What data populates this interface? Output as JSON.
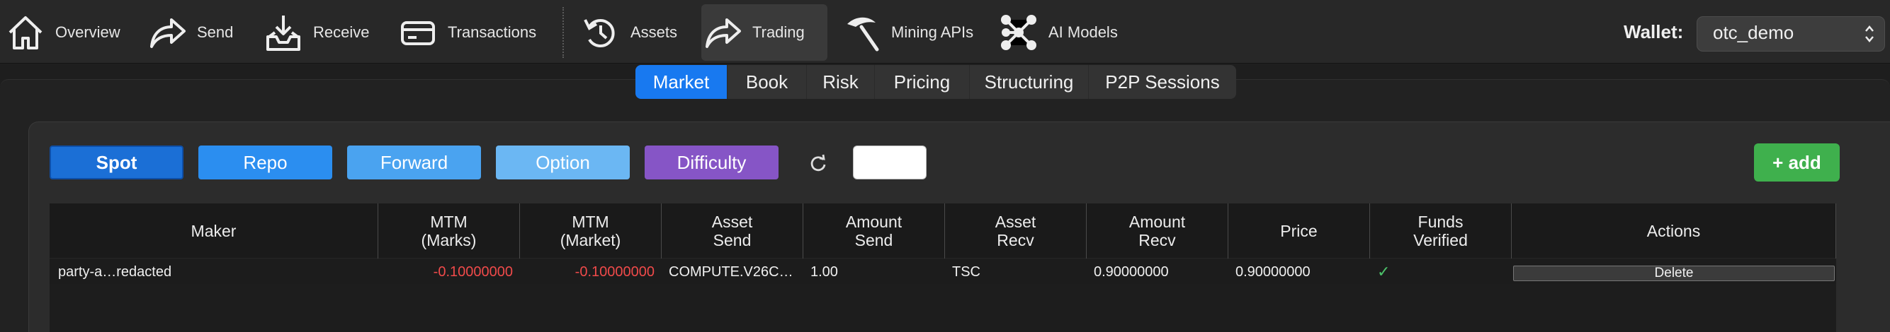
{
  "toolbar": {
    "items": [
      {
        "label": "Overview",
        "icon": "home-icon"
      },
      {
        "label": "Send",
        "icon": "send-arrow-icon"
      },
      {
        "label": "Receive",
        "icon": "receive-tray-icon"
      },
      {
        "label": "Transactions",
        "icon": "card-icon"
      },
      {
        "label": "Assets",
        "icon": "history-icon"
      },
      {
        "label": "Trading",
        "icon": "share-arrow-icon",
        "active": true
      },
      {
        "label": "Mining APIs",
        "icon": "pickaxe-icon"
      },
      {
        "label": "AI Models",
        "icon": "network-nodes-icon"
      }
    ],
    "wallet_label": "Wallet:",
    "wallet_value": "otc_demo"
  },
  "subtabs": [
    "Market",
    "Book",
    "Risk",
    "Pricing",
    "Structuring",
    "P2P Sessions"
  ],
  "active_subtab": "Market",
  "filters": [
    {
      "label": "Spot",
      "color": "#1b6fd6",
      "active": true
    },
    {
      "label": "Repo",
      "color": "#2b8ef0"
    },
    {
      "label": "Forward",
      "color": "#4aa3f0"
    },
    {
      "label": "Option",
      "color": "#6bb7f3"
    },
    {
      "label": "Difficulty",
      "color": "#8655c6"
    }
  ],
  "add_label": "+ add",
  "colors": {
    "accent": "#1879f0",
    "add": "#3fb04d",
    "negative": "#f04a4a",
    "verified": "#4cc26a"
  },
  "table": {
    "headers": [
      "Maker",
      "MTM\n(Marks)",
      "MTM\n(Market)",
      "Asset\nSend",
      "Amount\nSend",
      "Asset\nRecv",
      "Amount\nRecv",
      "Price",
      "Funds\nVerified",
      "Actions"
    ],
    "rows": [
      {
        "maker": "party-a…redacted",
        "mtm_marks": "-0.10000000",
        "mtm_market": "-0.10000000",
        "asset_send": "COMPUTE.V26C…",
        "amount_send": "1.00",
        "asset_recv": "TSC",
        "amount_recv": "0.90000000",
        "price": "0.90000000",
        "funds_verified": "✓",
        "action": "Delete"
      }
    ]
  }
}
